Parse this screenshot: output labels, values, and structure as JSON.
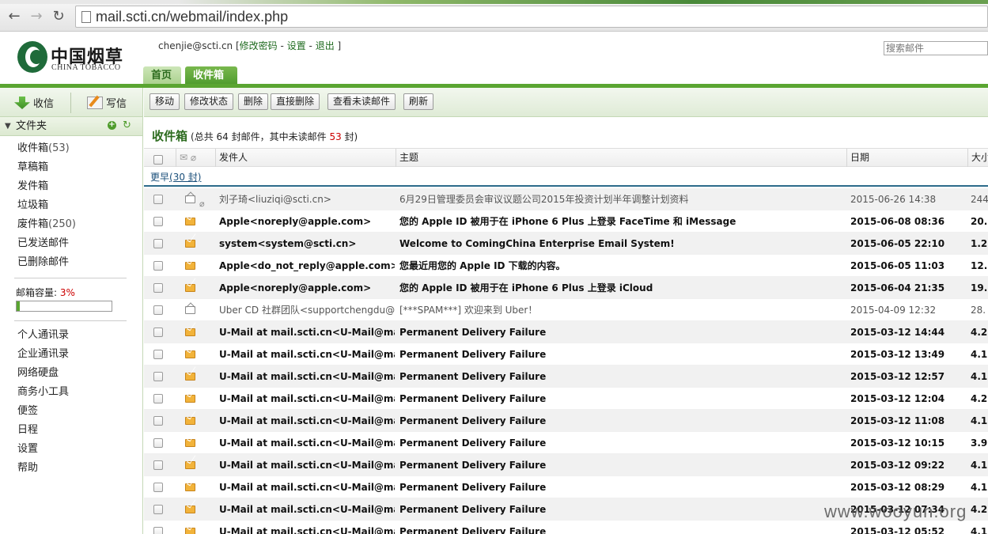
{
  "browser": {
    "url": "mail.scti.cn/webmail/index.php"
  },
  "header": {
    "logo_cn": "中国烟草",
    "logo_en": "CHINA TOBACCO",
    "user": "chenjie@scti.cn",
    "open_bracket": "[",
    "change_password": "修改密码",
    "sep1": "-",
    "settings": "设置",
    "sep2": "-",
    "logout": "退出",
    "close_bracket": "]",
    "search_placeholder": "搜索邮件",
    "tabs": [
      {
        "label": "首页"
      },
      {
        "label": "收件箱"
      }
    ]
  },
  "sidebar": {
    "receive": "收信",
    "compose": "写信",
    "folders_title": "文件夹",
    "folders": [
      {
        "label": "收件箱",
        "count": "(53)"
      },
      {
        "label": "草稿箱",
        "count": ""
      },
      {
        "label": "发件箱",
        "count": ""
      },
      {
        "label": "垃圾箱",
        "count": ""
      },
      {
        "label": "废件箱",
        "count": "(250)"
      },
      {
        "label": "已发送邮件",
        "count": ""
      },
      {
        "label": "已删除邮件",
        "count": ""
      }
    ],
    "quota_label": "邮箱容量:",
    "quota_pct": "3%",
    "quota_value": 0.03,
    "tools": [
      "个人通讯录",
      "企业通讯录",
      "网络硬盘",
      "商务小工具",
      "便签",
      "日程",
      "设置",
      "帮助"
    ]
  },
  "toolbar": {
    "buttons": [
      "移动",
      "修改状态",
      "删除",
      "直接删除",
      "查看未读邮件",
      "刷新"
    ]
  },
  "list": {
    "title": "收件箱",
    "summary_pre": "(总共 64 封邮件，其中未读邮件",
    "summary_unread": "53",
    "summary_post": "封)",
    "columns": {
      "from": "发件人",
      "subject": "主题",
      "date": "日期",
      "size": "大小"
    },
    "group_label": "更早",
    "group_count": "(30 封)",
    "rows": [
      {
        "from": "刘子琦<liuziqi@scti.cn>",
        "subject": "6月29日管理委员会审议议题公司2015年投资计划半年调整计划资料",
        "date": "2015-06-26 14:38",
        "size": "244",
        "read": true,
        "attach": true
      },
      {
        "from": "Apple<noreply@apple.com>",
        "subject": "您的 Apple ID 被用于在 iPhone 6 Plus 上登录 FaceTime 和 iMessage",
        "date": "2015-06-08 08:36",
        "size": "20.",
        "read": false,
        "attach": false
      },
      {
        "from": "system<system@scti.cn>",
        "subject": "Welcome to ComingChina Enterprise Email System!",
        "date": "2015-06-05 22:10",
        "size": "1.2",
        "read": false,
        "attach": false
      },
      {
        "from": "Apple<do_not_reply@apple.com>",
        "subject": "您最近用您的 Apple ID 下载的内容。",
        "date": "2015-06-05 11:03",
        "size": "12.",
        "read": false,
        "attach": false
      },
      {
        "from": "Apple<noreply@apple.com>",
        "subject": "您的 Apple ID 被用于在 iPhone 6 Plus 上登录 iCloud",
        "date": "2015-06-04 21:35",
        "size": "19.",
        "read": false,
        "attach": false
      },
      {
        "from": "Uber CD 社群团队<supportchengdu@ub",
        "subject": "[***SPAM***] 欢迎来到 Uber！",
        "date": "2015-04-09 12:32",
        "size": "28.",
        "read": true,
        "attach": false
      },
      {
        "from": "U-Mail at mail.scti.cn<U-Mail@mail.scti",
        "subject": "Permanent Delivery Failure",
        "date": "2015-03-12 14:44",
        "size": "4.2",
        "read": false,
        "attach": false
      },
      {
        "from": "U-Mail at mail.scti.cn<U-Mail@mail.scti",
        "subject": "Permanent Delivery Failure",
        "date": "2015-03-12 13:49",
        "size": "4.1",
        "read": false,
        "attach": false
      },
      {
        "from": "U-Mail at mail.scti.cn<U-Mail@mail.scti",
        "subject": "Permanent Delivery Failure",
        "date": "2015-03-12 12:57",
        "size": "4.1",
        "read": false,
        "attach": false
      },
      {
        "from": "U-Mail at mail.scti.cn<U-Mail@mail.scti",
        "subject": "Permanent Delivery Failure",
        "date": "2015-03-12 12:04",
        "size": "4.2",
        "read": false,
        "attach": false
      },
      {
        "from": "U-Mail at mail.scti.cn<U-Mail@mail.scti",
        "subject": "Permanent Delivery Failure",
        "date": "2015-03-12 11:08",
        "size": "4.1",
        "read": false,
        "attach": false
      },
      {
        "from": "U-Mail at mail.scti.cn<U-Mail@mail.scti",
        "subject": "Permanent Delivery Failure",
        "date": "2015-03-12 10:15",
        "size": "3.9",
        "read": false,
        "attach": false
      },
      {
        "from": "U-Mail at mail.scti.cn<U-Mail@mail.scti",
        "subject": "Permanent Delivery Failure",
        "date": "2015-03-12 09:22",
        "size": "4.1",
        "read": false,
        "attach": false
      },
      {
        "from": "U-Mail at mail.scti.cn<U-Mail@mail.scti",
        "subject": "Permanent Delivery Failure",
        "date": "2015-03-12 08:29",
        "size": "4.1",
        "read": false,
        "attach": false
      },
      {
        "from": "U-Mail at mail.scti.cn<U-Mail@mail.scti",
        "subject": "Permanent Delivery Failure",
        "date": "2015-03-12 07:34",
        "size": "4.2",
        "read": false,
        "attach": false
      },
      {
        "from": "U-Mail at mail.scti.cn<U-Mail@mail.scti",
        "subject": "Permanent Delivery Failure",
        "date": "2015-03-12 05:52",
        "size": "4.1",
        "read": false,
        "attach": false
      }
    ]
  },
  "watermark": "www.wooyun.org"
}
